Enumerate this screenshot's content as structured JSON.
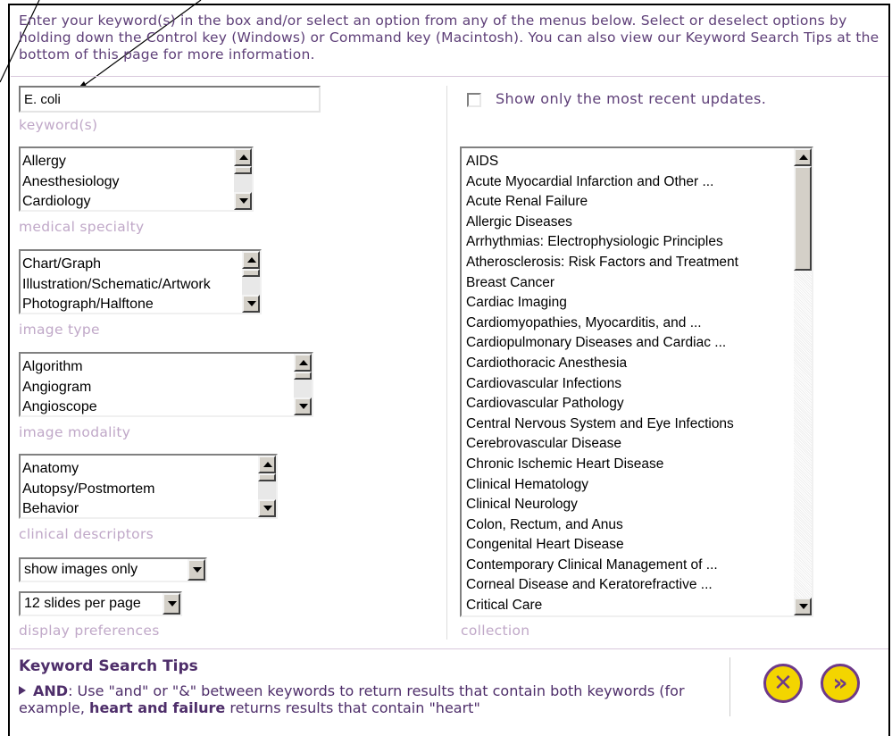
{
  "intro": "Enter your keyword(s) in the box and/or select an option from any of the menus below. Select or deselect options by holding down the Control key (Windows) or Command key (Macintosh). You can also view our Keyword Search Tips at the bottom of this page for more information.",
  "keyword": {
    "value": "E. coli",
    "label": "keyword(s)"
  },
  "specialty": {
    "label": "medical specialty",
    "options": [
      "Allergy",
      "Anesthesiology",
      "Cardiology"
    ]
  },
  "image_type": {
    "label": "image type",
    "options": [
      "Chart/Graph",
      "Illustration/Schematic/Artwork",
      "Photograph/Halftone"
    ]
  },
  "image_modality": {
    "label": "image modality",
    "options": [
      "Algorithm",
      "Angiogram",
      "Angioscope"
    ]
  },
  "clinical": {
    "label": "clinical descriptors",
    "options": [
      "Anatomy",
      "Autopsy/Postmortem",
      "Behavior"
    ]
  },
  "display": {
    "show_value": "show images only",
    "per_page_value": "12 slides per page",
    "label": "display preferences"
  },
  "recent": {
    "label": "Show only the most recent updates."
  },
  "collection": {
    "label": "collection",
    "options": [
      "AIDS",
      "Acute Myocardial Infarction and Other ...",
      "Acute Renal Failure",
      "Allergic Diseases",
      "Arrhythmias: Electrophysiologic Principles",
      "Atherosclerosis: Risk Factors and Treatment",
      "Breast Cancer",
      "Cardiac Imaging",
      "Cardiomyopathies, Myocarditis, and ...",
      "Cardiopulmonary Diseases and Cardiac ...",
      "Cardiothoracic Anesthesia",
      "Cardiovascular Infections",
      "Cardiovascular Pathology",
      "Central Nervous System and Eye Infections",
      "Cerebrovascular Disease",
      "Chronic Ischemic Heart Disease",
      "Clinical Hematology",
      "Clinical Neurology",
      "Colon, Rectum, and Anus",
      "Congenital Heart Disease",
      "Contemporary Clinical Management of ...",
      "Corneal Disease and Keratorefractive ...",
      "Critical Care"
    ]
  },
  "tips": {
    "title": "Keyword Search Tips",
    "and_label": "AND",
    "and_text_1": ": Use \"and\" or \"&\" between keywords to return results that contain both keywords (for example, ",
    "and_example": "heart and failure",
    "and_text_2": " returns results that contain \"heart\""
  },
  "buttons": {
    "clear_icon": "x-circle-icon",
    "go_icon": "double-chevron-right-icon"
  },
  "colors": {
    "label_purple": "#c0a8c8",
    "text_purple": "#5e3f78",
    "button_yellow": "#f3d500",
    "button_border": "#6e3a8a"
  }
}
